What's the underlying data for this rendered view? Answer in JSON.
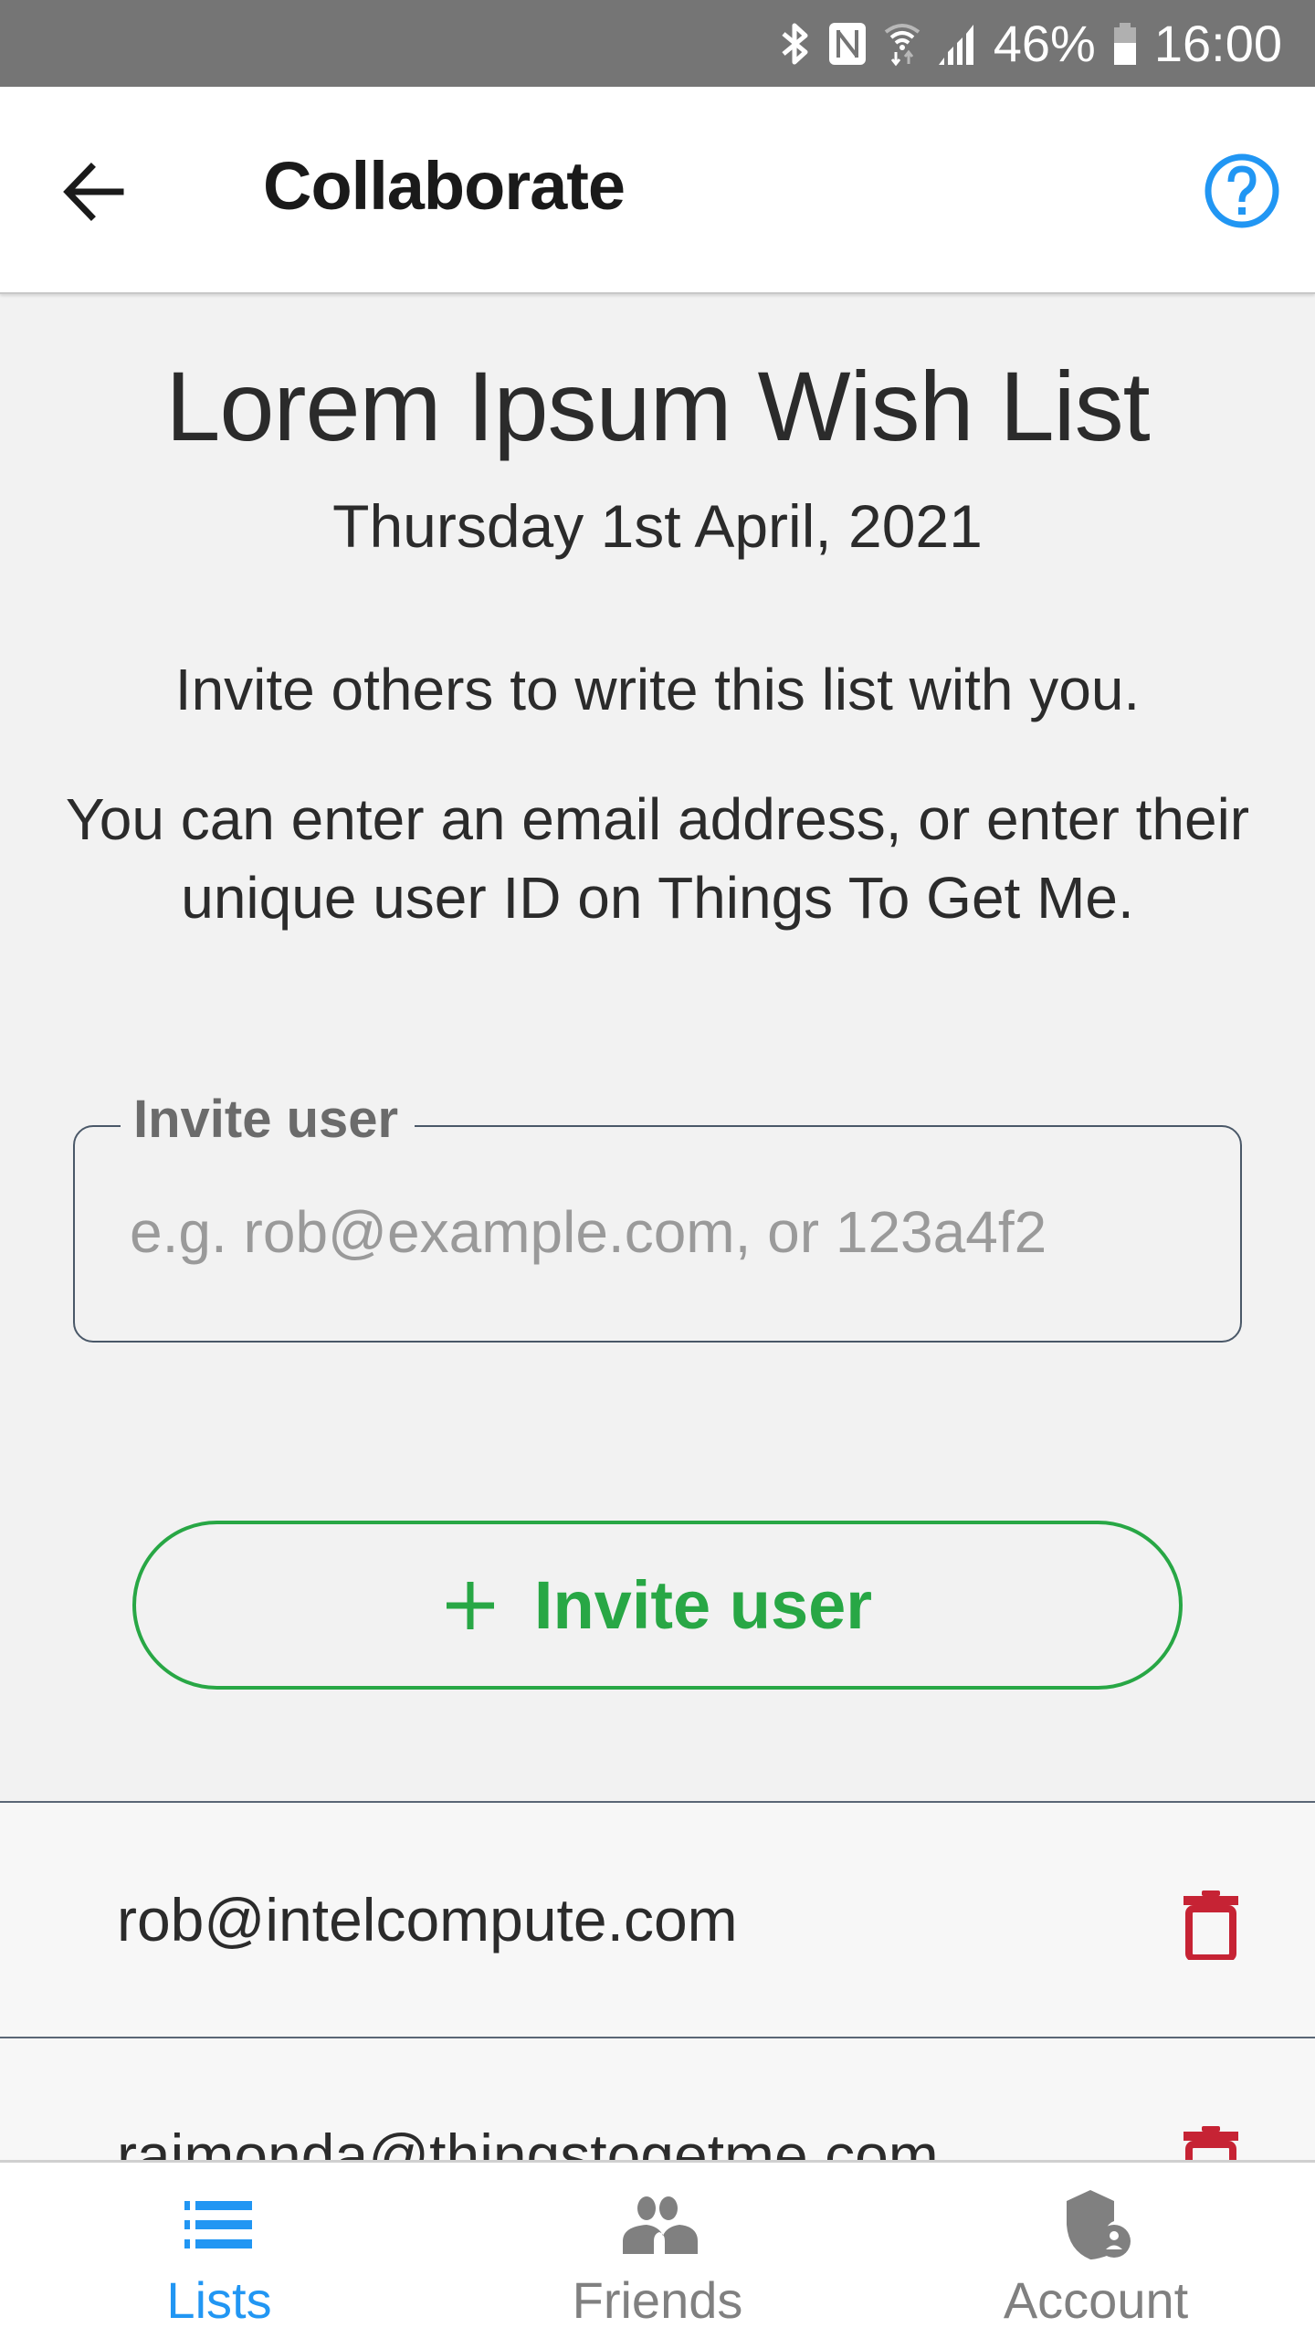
{
  "status_bar": {
    "icons": [
      "bluetooth-icon",
      "nfc-icon",
      "wifi-data-icon",
      "cell-signal-icon",
      "battery-icon"
    ],
    "battery_percent": "46%",
    "time": "16:00"
  },
  "app_bar": {
    "back_icon": "arrow-left-icon",
    "title": "Collaborate",
    "help_icon": "help-circle-icon",
    "accent_color": "#2196f3"
  },
  "main": {
    "list_title": "Lorem Ipsum Wish List",
    "list_date": "Thursday 1st April, 2021",
    "invite_text": "Invite others to write this list with you.",
    "invite_paragraph": "You can enter an email address, or enter their unique user ID on Things To Get Me.",
    "invite_field": {
      "label": "Invite user",
      "value": "",
      "placeholder": "e.g. rob@example.com, or 123a4f2"
    },
    "invite_button": {
      "icon": "plus-icon",
      "label": "Invite user",
      "color": "#28a745"
    }
  },
  "collaborators": [
    {
      "email": "rob@intelcompute.com",
      "delete_icon": "trash-icon"
    },
    {
      "email": "raimonda@thingstogetme.com",
      "delete_icon": "trash-icon"
    }
  ],
  "delete_color": "#c62334",
  "bottom_nav": {
    "items": [
      {
        "label": "Lists",
        "icon": "list-icon",
        "active": true
      },
      {
        "label": "Friends",
        "icon": "people-icon",
        "active": false
      },
      {
        "label": "Account",
        "icon": "shield-account-icon",
        "active": false
      }
    ],
    "active_color": "#2196f3",
    "inactive_color": "#808080"
  }
}
